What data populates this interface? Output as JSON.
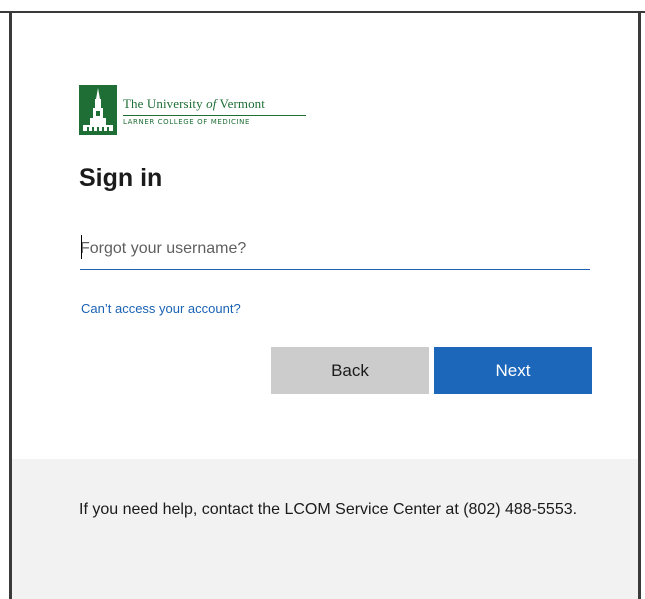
{
  "logo": {
    "line1_prefix": "The University ",
    "line1_of": "of",
    "line1_suffix": " Vermont",
    "line2": "LARNER COLLEGE OF MEDICINE",
    "color": "#1e6e35",
    "icon": "vermont-tower-logo"
  },
  "signin": {
    "title": "Sign in",
    "username_placeholder": "Forgot your username?",
    "username_value": "",
    "cant_access_link": "Can’t access your account?",
    "back_label": "Back",
    "next_label": "Next"
  },
  "footer": {
    "help_text": "If you need help, contact the LCOM Service Center at (802) 488-5553."
  },
  "colors": {
    "accent": "#1c67ba",
    "link": "#1a62b4",
    "back_button": "#cccccc",
    "footer_bg": "#f2f2f2"
  }
}
